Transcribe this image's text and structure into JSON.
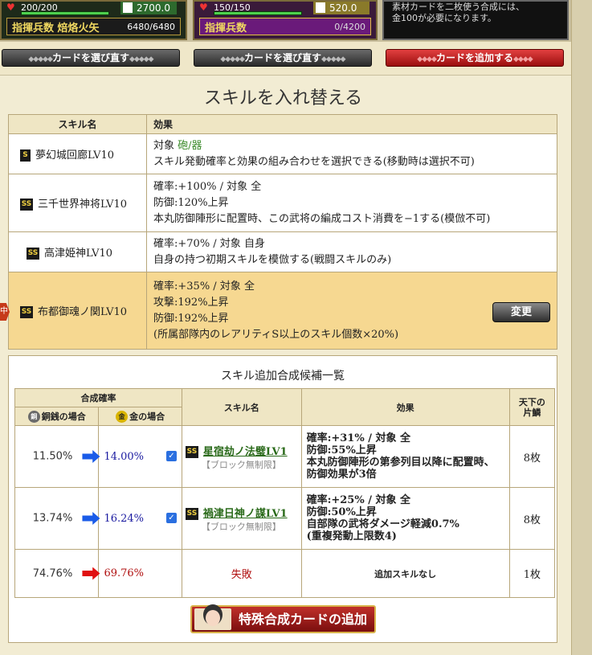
{
  "cards": [
    {
      "hp": "200/200",
      "atk": "2700.0",
      "troop_label": "指揮兵数",
      "troop_unit": "焙烙火矢",
      "troop_value": "6480/6480"
    },
    {
      "hp": "150/150",
      "atk": "520.0",
      "troop_label": "指揮兵数",
      "troop_unit": "",
      "troop_value": "0/4200"
    },
    {
      "info_line1": "素材カードを二枚使う合成には、",
      "info_line2": "金100が必要になります。"
    }
  ],
  "buttons": {
    "reselect_1": "カードを選び直す",
    "reselect_2": "カードを選び直す",
    "add_card": "カードを追加する"
  },
  "section_title": "スキルを入れ替える",
  "skill_table": {
    "headers": [
      "スキル名",
      "効果"
    ],
    "rows": [
      {
        "rank": "S",
        "name": "夢幻城回廊LV10",
        "lines": [
          "対象 砲/器",
          "スキル発動確率と効果の組み合わせを選択できる(移動時は選択不可)"
        ],
        "target_word": "砲/器"
      },
      {
        "rank": "SS",
        "name": "三千世界神将LV10",
        "lines": [
          "確率:+100% / 対象 全",
          "防御:120%上昇",
          "本丸防御陣形に配置時、この武将の編成コスト消費を−1する(模倣不可)"
        ]
      },
      {
        "rank": "SS",
        "name": "高津姫神LV10",
        "lines": [
          "確率:+70% / 対象 自身",
          "自身の持つ初期スキルを模倣する(戦闘スキルのみ)"
        ]
      },
      {
        "rank": "SS",
        "name": "布都御魂ノ関LV10",
        "lines": [
          "確率:+35% / 対象 全",
          "攻撃:192%上昇",
          "防御:192%上昇",
          "(所属部隊内のレアリティS以上のスキル個数×20%)"
        ],
        "selected": true,
        "change_label": "変更",
        "marker": "中"
      }
    ]
  },
  "candidates": {
    "title": "スキル追加合成候補一覧",
    "headers": {
      "rate": "合成確率",
      "copper": "銅銭の場合",
      "gold": "金の場合",
      "skill_name": "スキル名",
      "effect": "効果",
      "count_line1": "天下の",
      "count_line2": "片鱗"
    },
    "coin_copper_glyph": "銅",
    "coin_gold_glyph": "金",
    "rows": [
      {
        "copper_rate": "11.50%",
        "gold_rate": "14.00%",
        "arrow": "blue",
        "checked": true,
        "skill": "星宿劫ノ法璧LV1",
        "note": "【ブロック無制限】",
        "effect": [
          "確率:+31% / 対象 全",
          "防御:55%上昇",
          "本丸防御陣形の第参列目以降に配置時、防御効果が3倍"
        ],
        "count": "8枚"
      },
      {
        "copper_rate": "13.74%",
        "gold_rate": "16.24%",
        "arrow": "blue",
        "checked": true,
        "skill": "禍津日神ノ謀LV1",
        "note": "【ブロック無制限】",
        "effect": [
          "確率:+25% / 対象 全",
          "防御:50%上昇",
          "自部隊の武将ダメージ軽減0.7%",
          "(重複発動上限数4)"
        ],
        "count": "8枚"
      },
      {
        "copper_rate": "74.76%",
        "gold_rate": "69.76%",
        "arrow": "red",
        "checked": false,
        "fail_label": "失敗",
        "effect_text": "追加スキルなし",
        "count": "1枚"
      }
    ]
  },
  "special_add_button": "特殊合成カードの追加"
}
